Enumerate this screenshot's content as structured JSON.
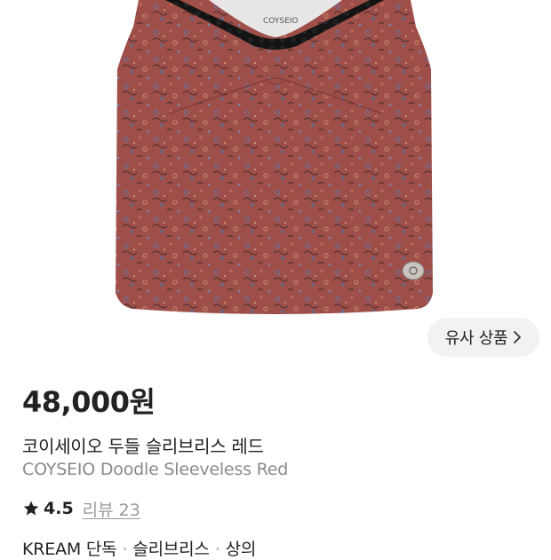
{
  "product": {
    "brand_print": "COYSEIO",
    "price": "48,000원",
    "name_ko": "코이세이오 두들 슬리브리스 레드",
    "name_en": "COYSEIO Doodle Sleeveless Red",
    "rating": "4.5",
    "review_label": "리뷰 23",
    "tags": [
      "KREAM 단독",
      "슬리브리스",
      "상의"
    ],
    "tag_separator": "·"
  },
  "similar_button": {
    "label": "유사 상품"
  },
  "icons": {
    "rating": "star-icon",
    "similar": "chevron-right-icon"
  },
  "colors": {
    "garment": "#a0504a",
    "lace": "#161616",
    "muted_text": "#8a8a8a",
    "button_bg": "#f2f2f2"
  }
}
